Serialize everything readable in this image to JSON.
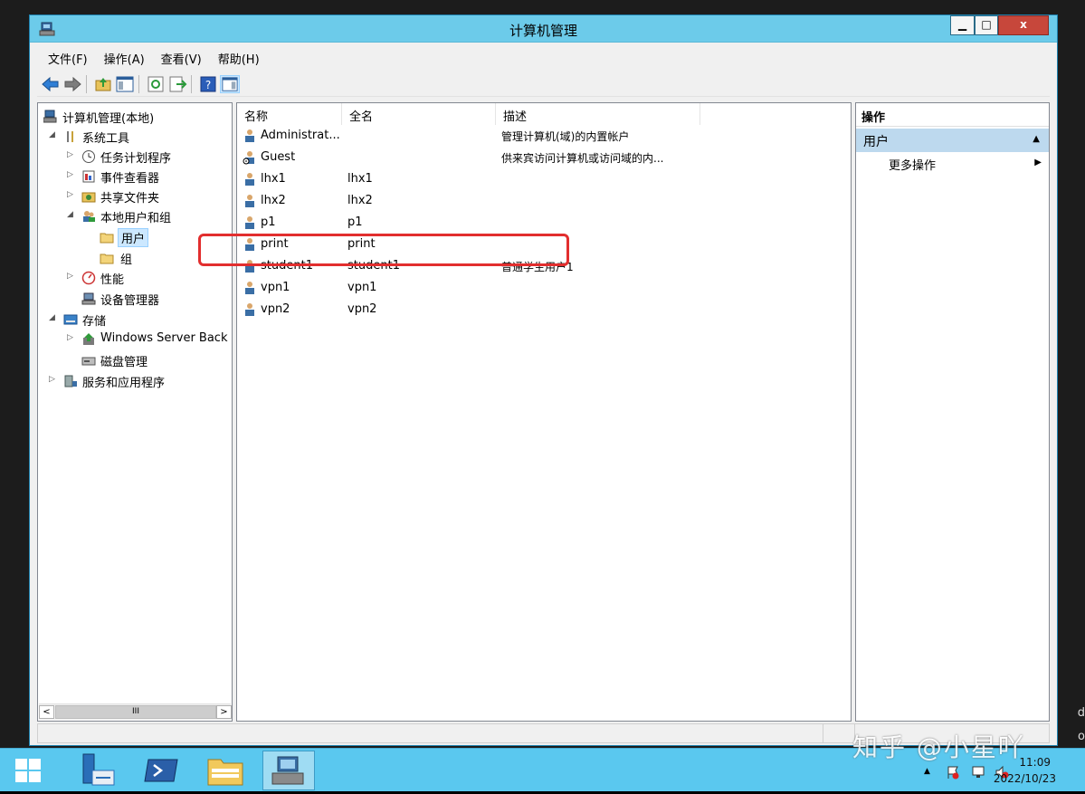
{
  "window": {
    "title": "计算机管理",
    "minimize": "▁",
    "maximize": "□",
    "close": "x"
  },
  "menu": [
    "文件(F)",
    "操作(A)",
    "查看(V)",
    "帮助(H)"
  ],
  "tree": {
    "items": [
      {
        "label": "计算机管理(本地)"
      },
      {
        "label": "系统工具"
      },
      {
        "label": "任务计划程序"
      },
      {
        "label": "事件查看器"
      },
      {
        "label": "共享文件夹"
      },
      {
        "label": "本地用户和组"
      },
      {
        "label": "用户"
      },
      {
        "label": "组"
      },
      {
        "label": "性能"
      },
      {
        "label": "设备管理器"
      },
      {
        "label": "存储"
      },
      {
        "label": "Windows Server Back"
      },
      {
        "label": "磁盘管理"
      },
      {
        "label": "服务和应用程序"
      }
    ],
    "scroll_thumb": "III"
  },
  "list": {
    "columns": [
      "名称",
      "全名",
      "描述"
    ],
    "rows": [
      {
        "name": "Administrat...",
        "full": "",
        "desc": "管理计算机(域)的内置帐户"
      },
      {
        "name": "Guest",
        "full": "",
        "desc": "供来宾访问计算机或访问域的内..."
      },
      {
        "name": "lhx1",
        "full": "lhx1",
        "desc": ""
      },
      {
        "name": "lhx2",
        "full": "lhx2",
        "desc": ""
      },
      {
        "name": "p1",
        "full": "p1",
        "desc": ""
      },
      {
        "name": "print",
        "full": "print",
        "desc": ""
      },
      {
        "name": "student1",
        "full": "student1",
        "desc": "普通学生用户1"
      },
      {
        "name": "vpn1",
        "full": "vpn1",
        "desc": ""
      },
      {
        "name": "vpn2",
        "full": "vpn2",
        "desc": ""
      }
    ]
  },
  "actions": {
    "header": "操作",
    "section": "用户",
    "more": "更多操作"
  },
  "taskbar": {
    "time": "11:09",
    "date": "2022/10/23"
  },
  "watermark": "知乎 @小星吖",
  "desktop_letters": [
    "d",
    "o"
  ],
  "colors": {
    "titlebar": "#6ccbea",
    "taskbar": "#5ac8ef",
    "close_button": "#c7473b",
    "highlight": "#e22e2e",
    "action_section": "#bdd9ee"
  }
}
